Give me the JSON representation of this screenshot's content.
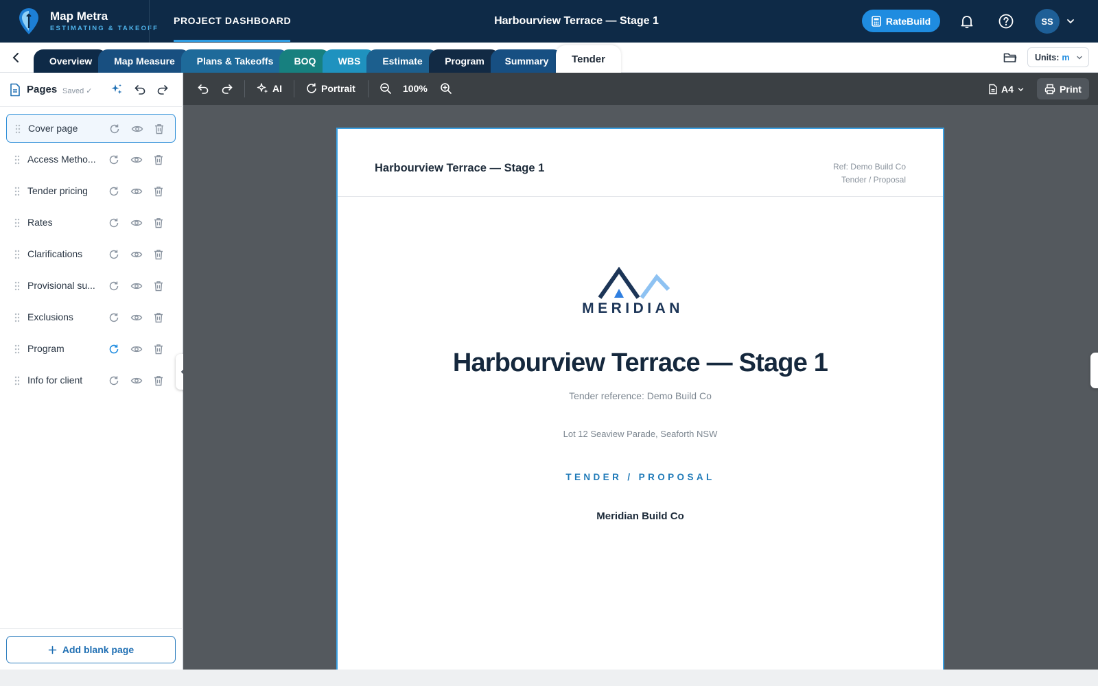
{
  "app": {
    "name": "Map Metra",
    "tagline": "ESTIMATING & TAKEOFF",
    "dashboard_link": "PROJECT DASHBOARD",
    "project_title": "Harbourview Terrace — Stage 1",
    "ratebuild_label": "RateBuild",
    "user_initials": "SS",
    "icons": [
      "map-pin-logo-icon",
      "bell-icon",
      "help-icon",
      "chevron-down-icon"
    ]
  },
  "tabs": [
    {
      "label": "Overview",
      "color": "#0e2a47"
    },
    {
      "label": "Map Measure",
      "color": "#184f80"
    },
    {
      "label": "Plans & Takeoffs",
      "color": "#1e6a9a"
    },
    {
      "label": "BOQ",
      "color": "#17807f"
    },
    {
      "label": "WBS",
      "color": "#1f92bf"
    },
    {
      "label": "Estimate",
      "color": "#1c5f8e"
    },
    {
      "label": "Program",
      "color": "#122a44"
    },
    {
      "label": "Summary",
      "color": "#174f82"
    },
    {
      "label": "Tender",
      "color": "#ffffff",
      "active": true
    }
  ],
  "units": {
    "label": "Units:",
    "value": "m"
  },
  "sidebar": {
    "title": "Pages",
    "saved": "Saved ✓",
    "pages": [
      {
        "label": "Cover page",
        "active": true
      },
      {
        "label": "Access Metho...",
        "active": false
      },
      {
        "label": "Tender pricing",
        "active": false
      },
      {
        "label": "Rates",
        "active": false
      },
      {
        "label": "Clarifications",
        "active": false
      },
      {
        "label": "Provisional su...",
        "active": false
      },
      {
        "label": "Exclusions",
        "active": false
      },
      {
        "label": "Program",
        "active": false,
        "refresh_highlight": true
      },
      {
        "label": "Info for client",
        "active": false
      }
    ],
    "add_page_label": "Add blank page"
  },
  "toolbar": {
    "ai_label": "AI",
    "orientation_label": "Portrait",
    "zoom_label": "100%",
    "paper_label": "A4",
    "print_label": "Print"
  },
  "document": {
    "header_title": "Harbourview Terrace — Stage 1",
    "ref_line1": "Ref: Demo Build Co",
    "ref_line2": "Tender / Proposal",
    "logo_word": "MERIDIAN",
    "title": "Harbourview Terrace — Stage 1",
    "subtitle": "Tender reference: Demo Build Co",
    "address": "Lot 12 Seaview Parade, Seaforth NSW",
    "kicker": "TENDER / PROPOSAL",
    "company": "Meridian Build Co"
  },
  "colors": {
    "nav_dark": "#0e2a47",
    "accent_blue": "#1f8ce0",
    "canvas_gray": "#54595e",
    "toolbar_gray": "#3b4044",
    "page_border": "#3aa0e3"
  }
}
